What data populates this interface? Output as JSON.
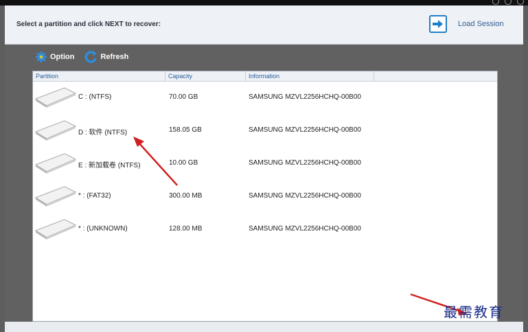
{
  "header": {
    "prompt": "Select a partition and click NEXT to recover:",
    "load_session_label": "Load Session"
  },
  "toolbar": {
    "option_label": "Option",
    "refresh_label": "Refresh"
  },
  "columns": [
    "Partition",
    "Capacity",
    "Information",
    ""
  ],
  "rows": [
    {
      "partition": "C :  (NTFS)",
      "capacity": "70.00 GB",
      "information": "SAMSUNG MZVL2256HCHQ-00B00",
      "selected": false
    },
    {
      "partition": "D : 软件  (NTFS)",
      "capacity": "158.05 GB",
      "information": "SAMSUNG MZVL2256HCHQ-00B00",
      "selected": true
    },
    {
      "partition": "E : 新加载卷  (NTFS)",
      "capacity": "10.00 GB",
      "information": "SAMSUNG MZVL2256HCHQ-00B00",
      "selected": false
    },
    {
      "partition": "* :  (FAT32)",
      "capacity": "300.00 MB",
      "information": "SAMSUNG MZVL2256HCHQ-00B00",
      "selected": false
    },
    {
      "partition": "* :  (UNKNOWN)",
      "capacity": "128.00 MB",
      "information": "SAMSUNG MZVL2256HCHQ-00B00",
      "selected": false
    }
  ],
  "watermark": "最需教育",
  "colors": {
    "selected_row": "#b7d3f4",
    "accent": "#1f7fc4",
    "annotation_arrow": "#d11f1f"
  }
}
